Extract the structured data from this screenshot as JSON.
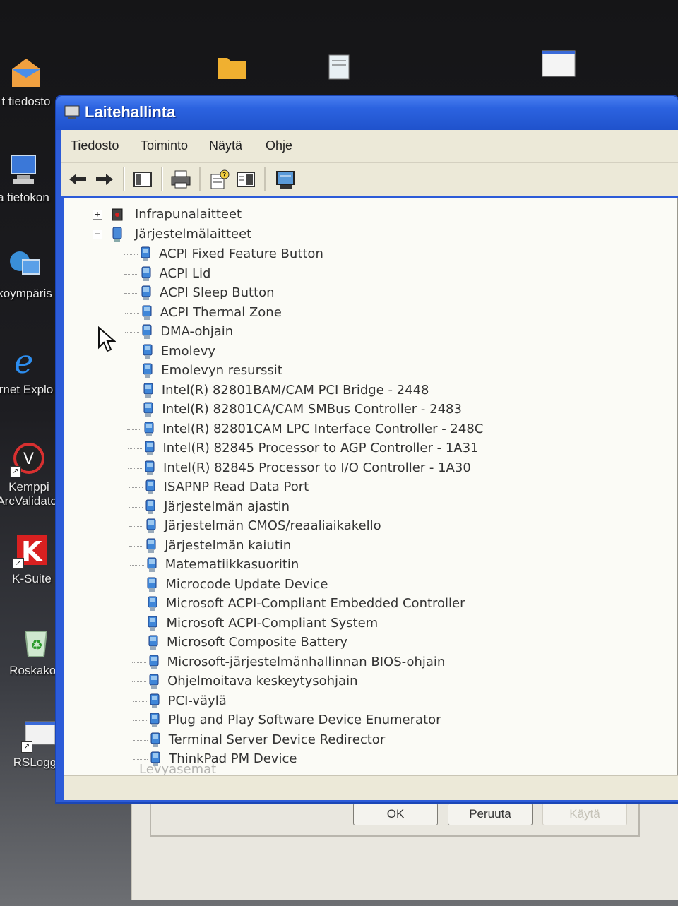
{
  "desktop": {
    "icons": [
      {
        "label": "t tiedosto",
        "icon": "envelope-icon"
      },
      {
        "label": "a tietokon",
        "icon": "computer-icon"
      },
      {
        "label": "koympäris",
        "icon": "network-icon"
      },
      {
        "label": "rnet Explo",
        "icon": "internet-explorer-icon"
      },
      {
        "label": "Kemppi",
        "label2": "ArcValidator",
        "icon": "kemppi-icon"
      },
      {
        "label": "K-Suite",
        "icon": "ksuite-icon"
      },
      {
        "label": "Roskakori",
        "icon": "recycle-bin-icon"
      },
      {
        "label": "RSLogger",
        "icon": "rslogger-icon"
      }
    ]
  },
  "window": {
    "title": "Laitehallinta",
    "menu": [
      "Tiedosto",
      "Toiminto",
      "Näytä",
      "Ohje"
    ],
    "toolbar": [
      "back-icon",
      "forward-icon",
      "tree-view-icon",
      "print-icon",
      "properties-icon",
      "help-icon",
      "scan-hardware-icon"
    ],
    "accent": "#2c5bd8"
  },
  "tree": {
    "categories": [
      {
        "label": "Infrapunalaitteet",
        "expanded": false
      },
      {
        "label": "Järjestelmälaitteet",
        "expanded": true
      }
    ],
    "devices": [
      "ACPI Fixed Feature Button",
      "ACPI Lid",
      "ACPI Sleep Button",
      "ACPI Thermal Zone",
      "DMA-ohjain",
      "Emolevy",
      "Emolevyn resurssit",
      "Intel(R) 82801BAM/CAM PCI Bridge - 2448",
      "Intel(R) 82801CA/CAM SMBus Controller - 2483",
      "Intel(R) 82801CAM LPC Interface Controller - 248C",
      "Intel(R) 82845 Processor to AGP Controller - 1A31",
      "Intel(R) 82845 Processor to I/O Controller - 1A30",
      "ISAPNP Read Data Port",
      "Järjestelmän ajastin",
      "Järjestelmän CMOS/reaaliaikakello",
      "Järjestelmän kaiutin",
      "Matematiikkasuoritin",
      "Microcode Update Device",
      "Microsoft ACPI-Compliant Embedded Controller",
      "Microsoft ACPI-Compliant System",
      "Microsoft Composite Battery",
      "Microsoft-järjestelmänhallinnan BIOS-ohjain",
      "Ohjelmoitava keskeytysohjain",
      "PCI-väylä",
      "Plug and Play Software Device Enumerator",
      "Terminal Server Device Redirector",
      "ThinkPad PM Device"
    ],
    "partial_next": "Levyasemat"
  },
  "background_dialog": {
    "ok": "OK",
    "cancel": "Peruuta",
    "apply": "Käytä"
  }
}
